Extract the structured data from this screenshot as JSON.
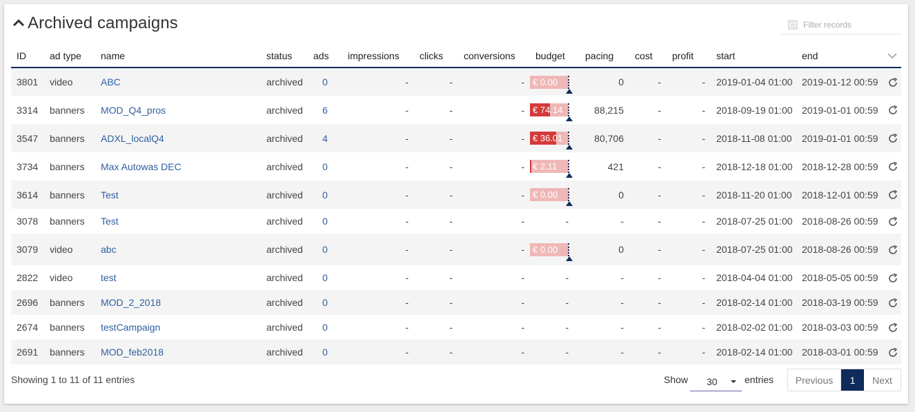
{
  "panel": {
    "title": "Archived campaigns",
    "filter_placeholder": "Filter records"
  },
  "columns": [
    "ID",
    "ad type",
    "name",
    "status",
    "ads",
    "impressions",
    "clicks",
    "conversions",
    "budget",
    "pacing",
    "cost",
    "profit",
    "start",
    "end"
  ],
  "rows": [
    {
      "id": "3801",
      "ad_type": "video",
      "name": "ABC",
      "status": "archived",
      "ads": "0",
      "impressions": "-",
      "clicks": "-",
      "conversions": "-",
      "budget": "€ 0.00",
      "budget_fill": 0.0,
      "pacing": "0",
      "cost": "-",
      "profit": "-",
      "start": "2019-01-04 01:00",
      "end": "2019-01-12 00:59"
    },
    {
      "id": "3314",
      "ad_type": "banners",
      "name": "MOD_Q4_pros",
      "status": "archived",
      "ads": "6",
      "impressions": "-",
      "clicks": "-",
      "conversions": "-",
      "budget": "€ 74.14",
      "budget_fill": 0.52,
      "pacing": "88,215",
      "cost": "-",
      "profit": "-",
      "start": "2018-09-19 01:00",
      "end": "2019-01-01 00:59"
    },
    {
      "id": "3547",
      "ad_type": "banners",
      "name": "ADXL_localQ4",
      "status": "archived",
      "ads": "4",
      "impressions": "-",
      "clicks": "-",
      "conversions": "-",
      "budget": "€ 36.01",
      "budget_fill": 0.68,
      "pacing": "80,706",
      "cost": "-",
      "profit": "-",
      "start": "2018-11-08 01:00",
      "end": "2019-01-01 00:59"
    },
    {
      "id": "3734",
      "ad_type": "banners",
      "name": "Max Autowas DEC",
      "status": "archived",
      "ads": "0",
      "impressions": "-",
      "clicks": "-",
      "conversions": "-",
      "budget": "€ 2.11",
      "budget_fill": 0.04,
      "pacing": "421",
      "cost": "-",
      "profit": "-",
      "start": "2018-12-18 01:00",
      "end": "2018-12-28 00:59"
    },
    {
      "id": "3614",
      "ad_type": "banners",
      "name": "Test",
      "status": "archived",
      "ads": "0",
      "impressions": "-",
      "clicks": "-",
      "conversions": "-",
      "budget": "€ 0.00",
      "budget_fill": 0.0,
      "pacing": "0",
      "cost": "-",
      "profit": "-",
      "start": "2018-11-20 01:00",
      "end": "2018-12-01 00:59"
    },
    {
      "id": "3078",
      "ad_type": "banners",
      "name": "Test",
      "status": "archived",
      "ads": "0",
      "impressions": "-",
      "clicks": "-",
      "conversions": "-",
      "budget": "-",
      "budget_fill": null,
      "pacing": "-",
      "cost": "-",
      "profit": "-",
      "start": "2018-07-25 01:00",
      "end": "2018-08-26 00:59"
    },
    {
      "id": "3079",
      "ad_type": "video",
      "name": "abc",
      "status": "archived",
      "ads": "0",
      "impressions": "-",
      "clicks": "-",
      "conversions": "-",
      "budget": "€ 0.00",
      "budget_fill": 0.0,
      "pacing": "0",
      "cost": "-",
      "profit": "-",
      "start": "2018-07-25 01:00",
      "end": "2018-08-26 00:59"
    },
    {
      "id": "2822",
      "ad_type": "video",
      "name": "test",
      "status": "archived",
      "ads": "0",
      "impressions": "-",
      "clicks": "-",
      "conversions": "-",
      "budget": "-",
      "budget_fill": null,
      "pacing": "-",
      "cost": "-",
      "profit": "-",
      "start": "2018-04-04 01:00",
      "end": "2018-05-05 00:59"
    },
    {
      "id": "2696",
      "ad_type": "banners",
      "name": "MOD_2_2018",
      "status": "archived",
      "ads": "0",
      "impressions": "-",
      "clicks": "-",
      "conversions": "-",
      "budget": "-",
      "budget_fill": null,
      "pacing": "-",
      "cost": "-",
      "profit": "-",
      "start": "2018-02-14 01:00",
      "end": "2018-03-19 00:59"
    },
    {
      "id": "2674",
      "ad_type": "banners",
      "name": "testCampaign",
      "status": "archived",
      "ads": "0",
      "impressions": "-",
      "clicks": "-",
      "conversions": "-",
      "budget": "-",
      "budget_fill": null,
      "pacing": "-",
      "cost": "-",
      "profit": "-",
      "start": "2018-02-02 01:00",
      "end": "2018-03-03 00:59"
    },
    {
      "id": "2691",
      "ad_type": "banners",
      "name": "MOD_feb2018",
      "status": "archived",
      "ads": "0",
      "impressions": "-",
      "clicks": "-",
      "conversions": "-",
      "budget": "-",
      "budget_fill": null,
      "pacing": "-",
      "cost": "-",
      "profit": "-",
      "start": "2018-02-14 01:00",
      "end": "2018-03-01 00:59"
    }
  ],
  "footer": {
    "info": "Showing 1 to 11 of 11 entries",
    "show_label": "Show",
    "page_size": "30",
    "entries_label": "entries",
    "prev_label": "Previous",
    "current_page": "1",
    "next_label": "Next"
  },
  "colors": {
    "accent": "#0f2b5b",
    "budget_bar": "#f0b7b7",
    "budget_fill": "#d43a3a",
    "link": "#2f5f9f"
  }
}
